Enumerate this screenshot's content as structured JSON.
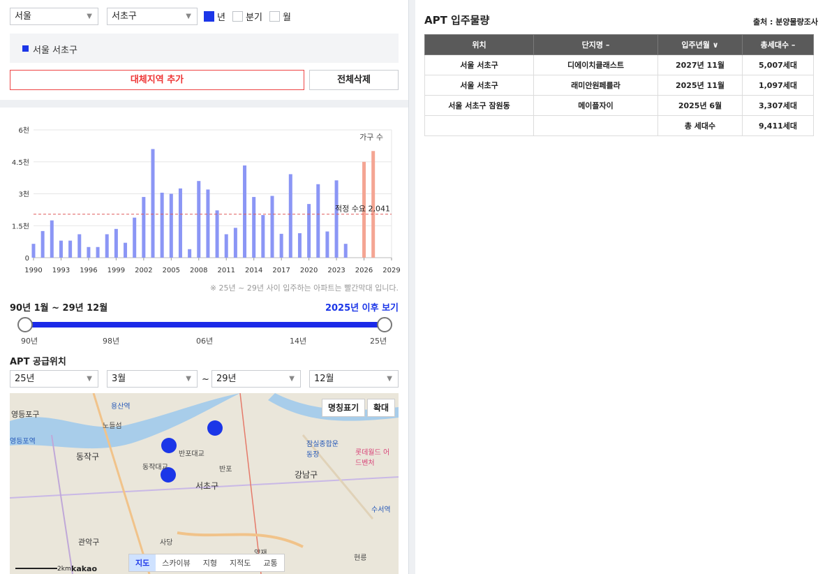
{
  "filters": {
    "city": "서울",
    "district": "서초구",
    "period_options": [
      {
        "label": "년",
        "checked": true
      },
      {
        "label": "분기",
        "checked": false
      },
      {
        "label": "월",
        "checked": false
      }
    ]
  },
  "selected_region": "서울 서초구",
  "buttons": {
    "add_region": "대체지역 추가",
    "clear_all": "전체삭제"
  },
  "chart_data": {
    "type": "bar",
    "legend_label": "가구 수",
    "reference_line": {
      "label": "적정 수요",
      "value": 2041,
      "value_label": "2,041"
    },
    "y_ticks": [
      "0",
      "1.5천",
      "3천",
      "4.5천",
      "6천"
    ],
    "ylim": [
      0,
      6000
    ],
    "x_ticks": [
      "1990",
      "1993",
      "1996",
      "1999",
      "2002",
      "2005",
      "2008",
      "2011",
      "2014",
      "2017",
      "2020",
      "2023",
      "2026",
      "2029"
    ],
    "years": [
      1990,
      1991,
      1992,
      1993,
      1994,
      1995,
      1996,
      1997,
      1998,
      1999,
      2000,
      2001,
      2002,
      2003,
      2004,
      2005,
      2006,
      2007,
      2008,
      2009,
      2010,
      2011,
      2012,
      2013,
      2014,
      2015,
      2016,
      2017,
      2018,
      2019,
      2020,
      2021,
      2022,
      2023,
      2024,
      2025,
      2026,
      2027
    ],
    "values": [
      650,
      1250,
      1750,
      800,
      800,
      1100,
      500,
      500,
      1100,
      1350,
      700,
      1880,
      2850,
      5100,
      3050,
      3000,
      3250,
      400,
      3600,
      3200,
      2220,
      1100,
      1400,
      4330,
      2850,
      2000,
      2900,
      1120,
      3920,
      1150,
      2520,
      3450,
      1230,
      3630,
      650,
      0,
      4500,
      5007
    ],
    "future_series": {
      "name": "2025년 이후",
      "color": "#f4a593",
      "years": [
        2025,
        2026,
        2027
      ]
    },
    "colors": {
      "past": "#8b96f5",
      "future": "#f4a593",
      "reference": "#e05a5a"
    }
  },
  "chart_note": "※ 25년 ~ 29년 사이 입주하는 아파트는 빨간막대 입니다.",
  "range": {
    "title": "90년 1월 ~ 29년 12월",
    "link": "2025년 이후 보기",
    "ticks": [
      "90년",
      "98년",
      "06년",
      "14년",
      "25년"
    ]
  },
  "supply": {
    "title": "APT 공급위치",
    "from_year": "25년",
    "from_month": "3월",
    "to_year": "29년",
    "to_month": "12월",
    "tilde": "~"
  },
  "map": {
    "buttons": [
      "명칭표기",
      "확대"
    ],
    "tabs": [
      "지도",
      "스카이뷰",
      "지형",
      "지적도",
      "교통"
    ],
    "active_tab": "지도",
    "labels": [
      "영등포구",
      "영등포역",
      "노들섬",
      "용산역",
      "동작구",
      "반포대교",
      "동작대교",
      "반포",
      "서초구",
      "강남구",
      "잠실종합운동장",
      "롯데월드 어드벤처",
      "수서역",
      "관악구",
      "사당",
      "양재",
      "현릉"
    ],
    "scale": "2km",
    "logo": "kakao"
  },
  "right_panel": {
    "title": "APT 입주물량",
    "source": "출처 : 분양물량조사",
    "columns": [
      "위치",
      "단지명 –",
      "입주년월 ∨",
      "총세대수 –"
    ],
    "rows": [
      [
        "서울 서초구",
        "디에이치클래스트",
        "2027년 11월",
        "5,007세대"
      ],
      [
        "서울 서초구",
        "래미안원페를라",
        "2025년 11월",
        "1,097세대"
      ],
      [
        "서울 서초구 잠원동",
        "메이플자이",
        "2025년 6월",
        "3,307세대"
      ]
    ],
    "total_label": "총 세대수",
    "total_value": "9,411세대"
  }
}
